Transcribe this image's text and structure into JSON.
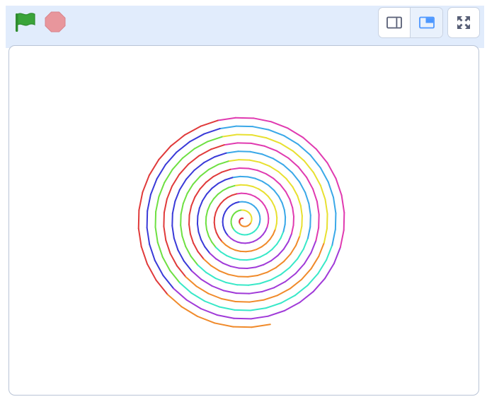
{
  "toolbar": {
    "green_flag": {
      "icon": "green-flag-icon",
      "color": "#3aa43a"
    },
    "stop": {
      "icon": "stop-octagon-icon",
      "color": "#e8969c"
    },
    "layout_buttons": [
      {
        "icon": "small-stage-icon",
        "selected": false
      },
      {
        "icon": "large-stage-icon",
        "selected": true
      }
    ],
    "fullscreen": {
      "icon": "fullscreen-icon"
    }
  },
  "colors": {
    "header_background": "#e1ecfc",
    "button_border": "#c8d2e2",
    "icon_color": "#575e75",
    "selected_icon_color": "#4c97ff"
  },
  "stage": {
    "drawing": {
      "shape": "spiral",
      "turns": 12.5,
      "segments_per_turn": 36,
      "colors": [
        "#e03a3a",
        "#f08a2a",
        "#e8e030",
        "#6ee042",
        "#38e8c8",
        "#3aa8e8",
        "#3a3ad8",
        "#a03ad8",
        "#e03ab0"
      ]
    }
  }
}
